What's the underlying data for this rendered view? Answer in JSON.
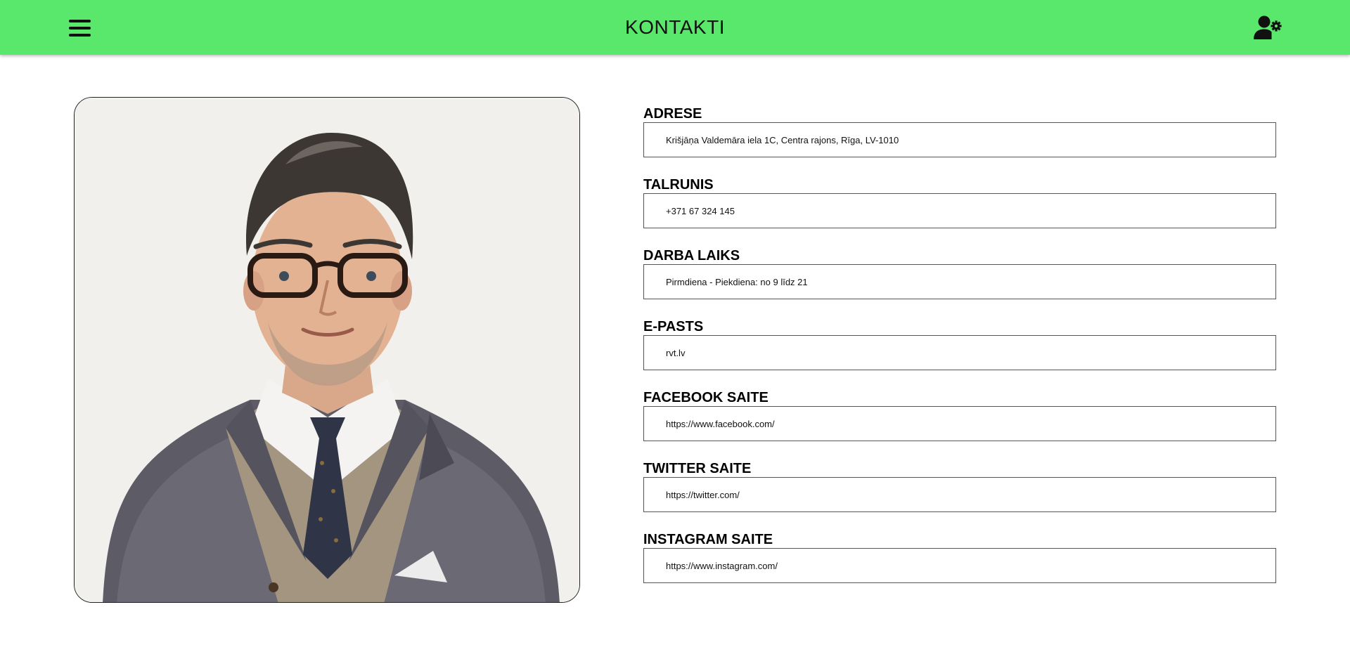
{
  "header": {
    "title": "KONTAKTI",
    "background": "#59e86b",
    "menu_icon": "hamburger-menu-icon",
    "user_icon": "user-settings-icon"
  },
  "profile_image": {
    "icon": "portrait-photo"
  },
  "fields": [
    {
      "label": "ADRESE",
      "value": "Krišjāņa Valdemāra iela 1C, Centra rajons, Rīga, LV-1010"
    },
    {
      "label": "TALRUNIS",
      "value": "+371 67 324 145"
    },
    {
      "label": "DARBA LAIKS",
      "value": "Pirmdiena - Piekdiena: no 9 līdz 21"
    },
    {
      "label": "E-PASTS",
      "value": "rvt.lv"
    },
    {
      "label": "FACEBOOK SAITE",
      "value": "https://www.facebook.com/"
    },
    {
      "label": "TWITTER SAITE",
      "value": "https://twitter.com/"
    },
    {
      "label": "INSTAGRAM SAITE",
      "value": "https://www.instagram.com/"
    }
  ]
}
